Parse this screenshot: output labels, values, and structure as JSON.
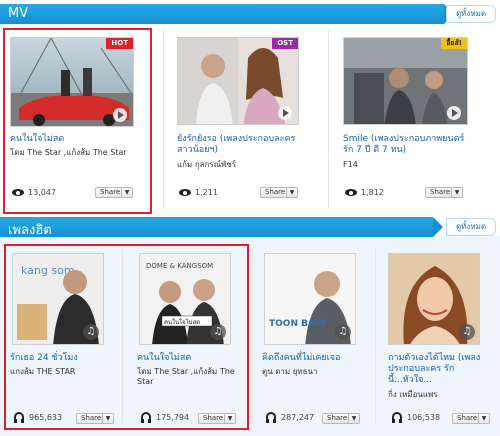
{
  "mv_section": {
    "title": "MV",
    "see_all": "ดูทั้งหมด",
    "items": [
      {
        "badge": "HOT",
        "badge_color": "#e0202a",
        "title": "คนในใจไม่สด",
        "artist": "โดม The Star ,แก้งส้ม The Star",
        "views": "13,047"
      },
      {
        "badge": "OST",
        "badge_color": "#9b2aa5",
        "title": "ยังรักยังรอ (เพลงประกอบละคร สาวน้อยฯ)",
        "artist": "แก้ม กุลกรณ์พัชร์",
        "views": "1,211"
      },
      {
        "badge": "อื้ยส์!",
        "badge_color": "#f2c21a",
        "title": "Smile (เพลงประกอบภาพยนตร์ รัก 7 ปี ดี 7 หน)",
        "artist": "F14",
        "views": "1,812"
      }
    ]
  },
  "hit_section": {
    "title": "เพลงฮิต",
    "see_all": "ดูทั้งหมด",
    "items": [
      {
        "cover_text": "kang som",
        "title": "รักเธอ 24 ชั่วโมง",
        "artist": "แกงส้ม THE STAR",
        "plays": "965,633"
      },
      {
        "cover_text": "DOME & KANGSOM",
        "cover_sub": "คนในใจไม่สด",
        "title": "คนในใจไม่สด",
        "artist": "โดม The Star ,แก้งส้ม The Star",
        "plays": "175,794"
      },
      {
        "cover_text": "TOON BAIN",
        "title": "คิดถึงคนที่ไม่เคยเจอ",
        "artist": "ตูน ดาม ยุทธนา",
        "plays": "287,247"
      },
      {
        "title": "ถามตัวเองได้ไหม (เพลงประกอบละคร รักนี้...หัวใจ...",
        "artist": "กิ่ง เหมือนแพร",
        "plays": "106,538"
      }
    ]
  },
  "share_label": "Share",
  "dropdown_glyph": "▼",
  "colors": {
    "accent": "#1a9ee0",
    "link": "#1a5fb4",
    "highlight": "#e0202a"
  }
}
